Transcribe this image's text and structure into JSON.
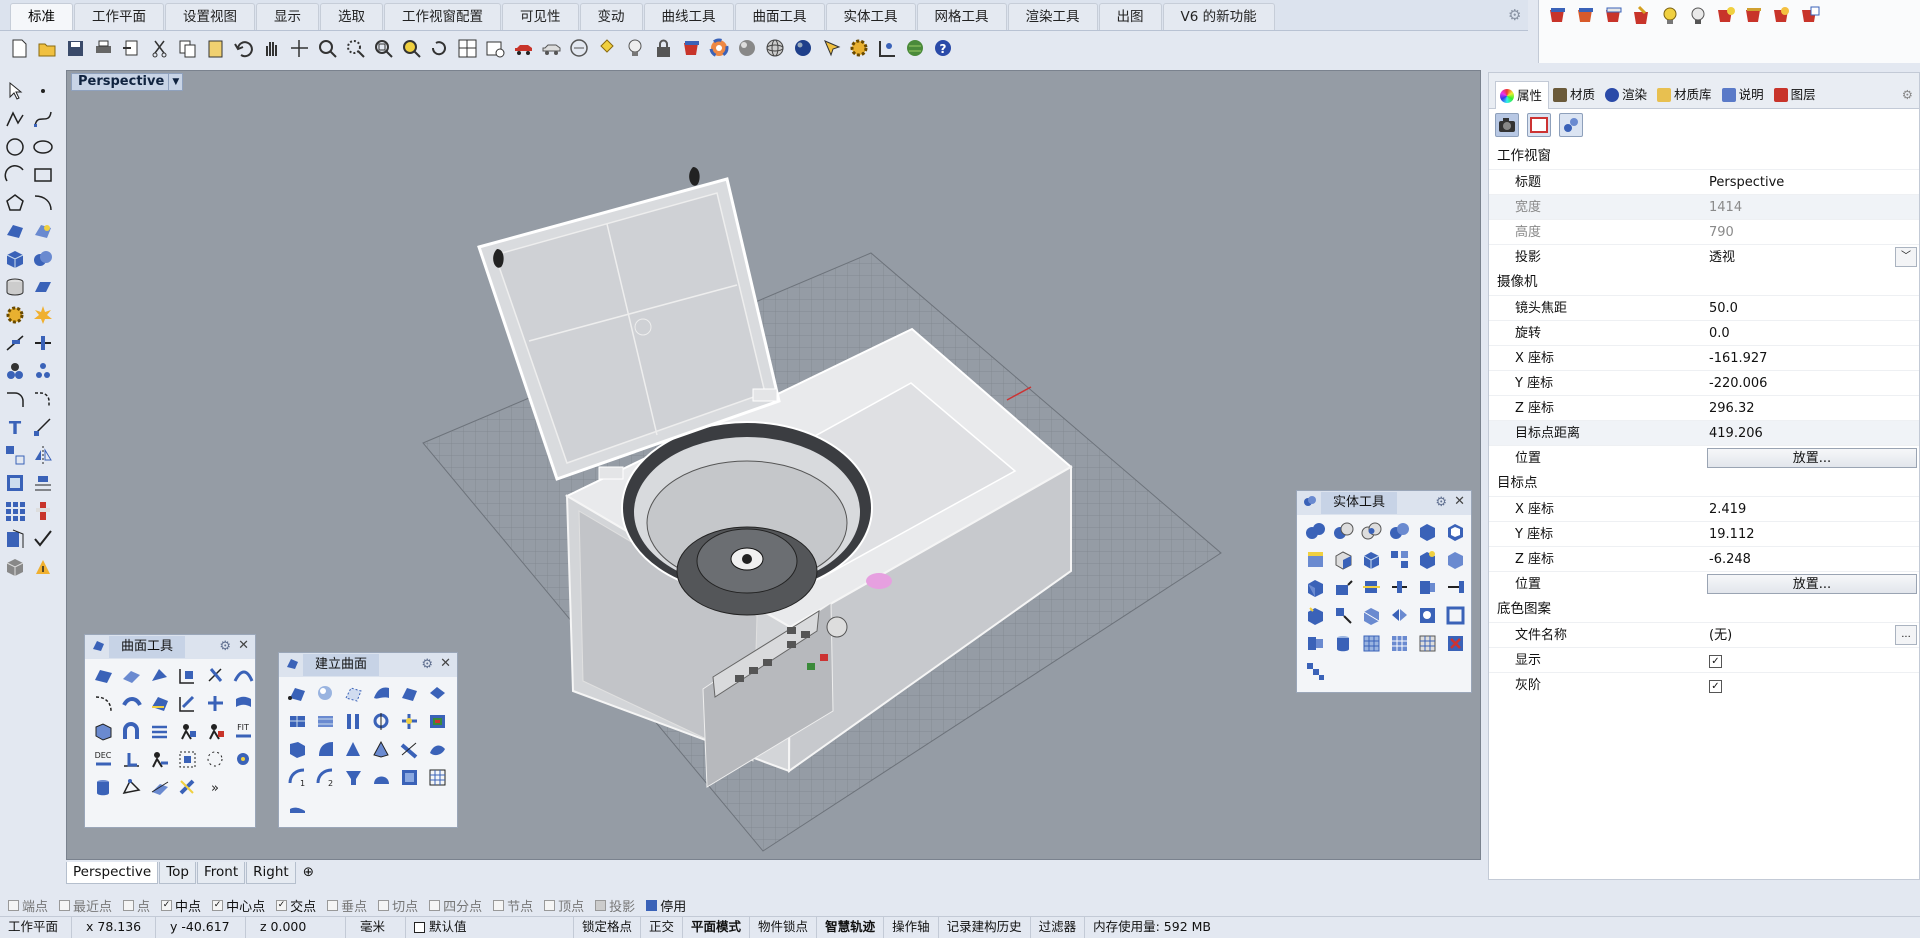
{
  "tabs": [
    "标准",
    "工作平面",
    "设置视图",
    "显示",
    "选取",
    "工作视窗配置",
    "可见性",
    "变动",
    "曲线工具",
    "曲面工具",
    "实体工具",
    "网格工具",
    "渲染工具",
    "出图",
    "V6 的新功能"
  ],
  "viewport": {
    "title": "Perspective",
    "tabs": [
      "Perspective",
      "Top",
      "Front",
      "Right"
    ]
  },
  "panels": {
    "surface_tools": "曲面工具",
    "create_surface": "建立曲面",
    "solid_tools": "实体工具",
    "fit_label": "FIT",
    "dec_label": "DEC",
    "more": "»"
  },
  "right_panel": {
    "tabs": [
      "属性",
      "材质",
      "渲染",
      "材质库",
      "说明",
      "图层"
    ],
    "sections": {
      "viewport": "工作视窗",
      "camera": "摄像机",
      "target": "目标点",
      "wallpaper": "底色图案"
    },
    "viewport_rows": [
      {
        "k": "标题",
        "v": "Perspective"
      },
      {
        "k": "宽度",
        "v": "1414"
      },
      {
        "k": "高度",
        "v": "790"
      },
      {
        "k": "投影",
        "v": "透视"
      }
    ],
    "camera_rows": [
      {
        "k": "镜头焦距",
        "v": "50.0"
      },
      {
        "k": "旋转",
        "v": "0.0"
      },
      {
        "k": "X 座标",
        "v": "-161.927"
      },
      {
        "k": "Y 座标",
        "v": "-220.006"
      },
      {
        "k": "Z 座标",
        "v": "296.32"
      },
      {
        "k": "目标点距离",
        "v": "419.206"
      },
      {
        "k": "位置",
        "v": "放置..."
      }
    ],
    "target_rows": [
      {
        "k": "X 座标",
        "v": "2.419"
      },
      {
        "k": "Y 座标",
        "v": "19.112"
      },
      {
        "k": "Z 座标",
        "v": "-6.248"
      },
      {
        "k": "位置",
        "v": "放置..."
      }
    ],
    "wallpaper_rows": [
      {
        "k": "文件名称",
        "v": "(无)",
        "btn": "..."
      },
      {
        "k": "显示",
        "v": "✓"
      },
      {
        "k": "灰阶",
        "v": "✓"
      }
    ]
  },
  "snaps": [
    {
      "label": "端点",
      "on": false
    },
    {
      "label": "最近点",
      "on": false
    },
    {
      "label": "点",
      "on": false
    },
    {
      "label": "中点",
      "on": true
    },
    {
      "label": "中心点",
      "on": true
    },
    {
      "label": "交点",
      "on": true
    },
    {
      "label": "垂点",
      "on": false
    },
    {
      "label": "切点",
      "on": false
    },
    {
      "label": "四分点",
      "on": false
    },
    {
      "label": "节点",
      "on": false
    },
    {
      "label": "顶点",
      "on": false
    },
    {
      "label": "投影",
      "on": false
    },
    {
      "label": "停用",
      "on": false
    }
  ],
  "status": [
    "工作平面",
    "x 78.136",
    "y -40.617",
    "z 0.000",
    "毫米",
    "默认值",
    "锁定格点",
    "正交",
    "平面模式",
    "物件锁点",
    "智慧轨迹",
    "操作轴",
    "记录建构历史",
    "过滤器",
    "内存使用量: 592 MB"
  ],
  "colors": {
    "accent": "#3b5ea8",
    "viewport_bg": "#959ca5",
    "tab_bar": "#dce3ee",
    "icon_red": "#c8342a",
    "icon_blue": "#3a62b8"
  }
}
